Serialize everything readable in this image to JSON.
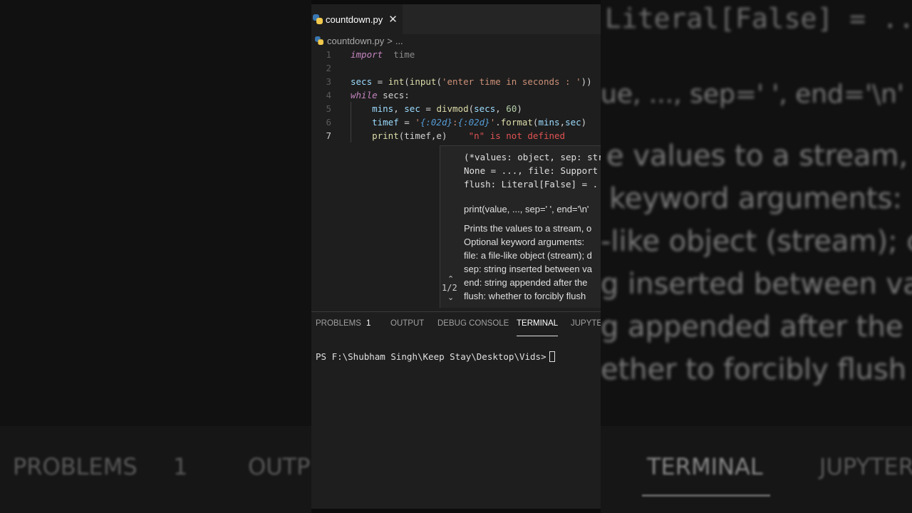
{
  "editor": {
    "tab": {
      "filename": "countdown.py",
      "close_glyph": "✕",
      "icon": "python-icon"
    },
    "breadcrumb": {
      "filename": "countdown.py",
      "separator": ">",
      "trail": "..."
    },
    "lines": [
      {
        "n": "1",
        "tokens": [
          [
            "kw",
            "import"
          ],
          [
            "",
            "  "
          ],
          [
            "muted",
            "time"
          ]
        ]
      },
      {
        "n": "2",
        "tokens": []
      },
      {
        "n": "3",
        "tokens": [
          [
            "var",
            "secs"
          ],
          [
            "",
            " = "
          ],
          [
            "fn",
            "int"
          ],
          [
            "",
            "("
          ],
          [
            "fn",
            "input"
          ],
          [
            "",
            "("
          ],
          [
            "str",
            "'enter time in seconds : '"
          ],
          [
            "",
            "))"
          ]
        ]
      },
      {
        "n": "4",
        "tokens": [
          [
            "ctrl",
            "while"
          ],
          [
            "",
            " secs:"
          ]
        ]
      },
      {
        "n": "5",
        "tokens": [
          [
            "",
            "    "
          ],
          [
            "var",
            "mins"
          ],
          [
            "",
            ", "
          ],
          [
            "var",
            "sec"
          ],
          [
            "",
            " = "
          ],
          [
            "fn",
            "divmod"
          ],
          [
            "",
            "("
          ],
          [
            "var",
            "secs"
          ],
          [
            "",
            ", "
          ],
          [
            "num",
            "60"
          ],
          [
            "",
            ")"
          ]
        ]
      },
      {
        "n": "6",
        "tokens": [
          [
            "",
            "    "
          ],
          [
            "var",
            "timef"
          ],
          [
            "",
            " = "
          ],
          [
            "str",
            "'"
          ],
          [
            "fmt",
            "{:02d}"
          ],
          [
            "str",
            ":"
          ],
          [
            "fmt",
            "{:02d}"
          ],
          [
            "str",
            "'"
          ],
          [
            "",
            "."
          ],
          [
            "fn",
            "format"
          ],
          [
            "",
            "("
          ],
          [
            "var",
            "mins"
          ],
          [
            "",
            ","
          ],
          [
            "var",
            "sec"
          ],
          [
            "",
            ")"
          ]
        ]
      },
      {
        "n": "7",
        "tokens": [
          [
            "",
            "    "
          ],
          [
            "fn",
            "print"
          ],
          [
            "",
            "(timef,e)"
          ]
        ]
      }
    ],
    "error_hint": "\"n\" is not defined"
  },
  "hover": {
    "signature": [
      "(*values: object, sep: str",
      "None = ..., file: Support",
      "flush: Literal[False] = ."
    ],
    "doc": [
      "print(value, ..., sep=' ', end='\\n'",
      "Prints the values to a stream, o",
      "Optional keyword arguments:",
      "file:  a file-like object (stream); d",
      "sep:   string inserted between va",
      "end:   string appended after the",
      "flush: whether to forcibly flush"
    ],
    "pager": "1/2",
    "up_glyph": "⌃",
    "down_glyph": "⌄"
  },
  "panel": {
    "tabs": [
      "PROBLEMS",
      "OUTPUT",
      "DEBUG CONSOLE",
      "TERMINAL",
      "JUPYTER"
    ],
    "problems_count": "1",
    "active_tab": "TERMINAL",
    "terminal_prompt": "PS F:\\Shubham Singh\\Keep Stay\\Desktop\\Vids>"
  },
  "backdrop": {
    "right_lines": [
      "Literal[False] = ..",
      "ue, ..., sep=' ', end='\\n'",
      "e values to a stream, o",
      "keyword arguments:",
      "-like object (stream); c",
      "g inserted between va",
      "g appended after the",
      "ether to forcibly flush"
    ],
    "bottom_left": [
      "PROBLEMS",
      "1",
      "OUTP"
    ],
    "bottom_right": [
      "TERMINAL",
      "JUPYTER"
    ]
  }
}
